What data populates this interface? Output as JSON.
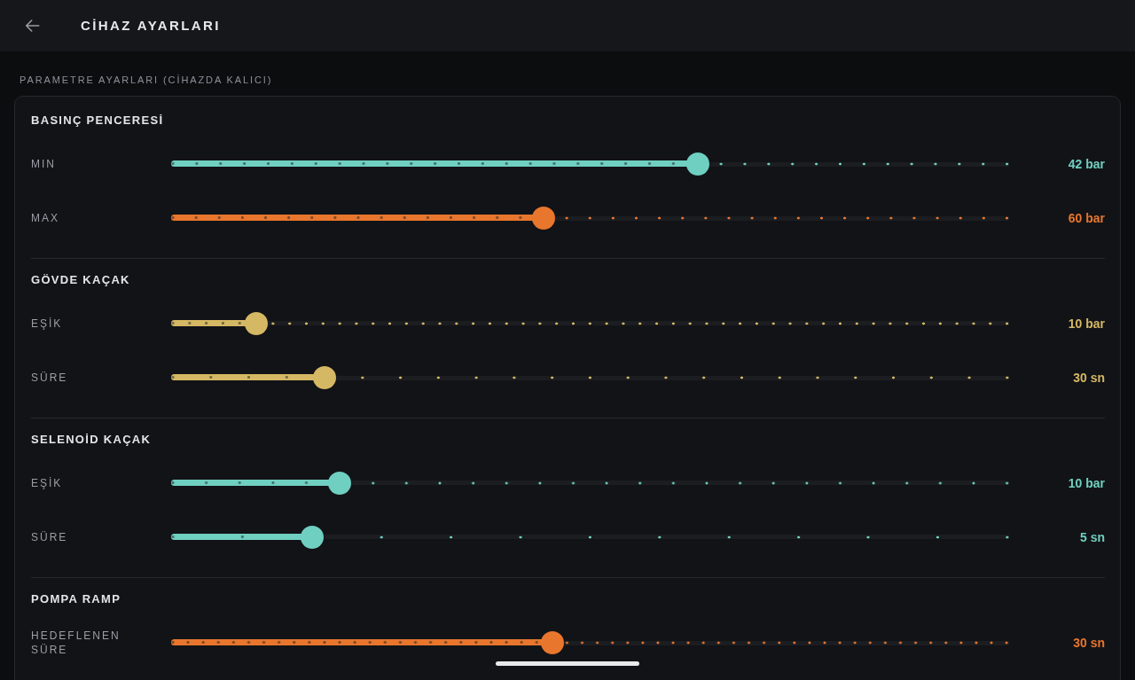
{
  "header": {
    "title": "CİHAZ AYARLARI"
  },
  "section_label": "PARAMETRE AYARLARI (CİHAZDA KALICI)",
  "groups": [
    {
      "title": "BASINÇ PENCERESİ",
      "sliders": [
        {
          "label": "MIN",
          "level": 0.629,
          "value": "42 bar",
          "color": "#6fcfc0"
        },
        {
          "label": "MAX",
          "level": 0.444,
          "value": "60 bar",
          "color": "#e8762d"
        }
      ]
    },
    {
      "title": "GÖVDE KAÇAK",
      "sliders": [
        {
          "label": "EŞİK",
          "level": 0.1,
          "value": "10 bar",
          "color": "#d5b863"
        },
        {
          "label": "SÜRE",
          "level": 0.182,
          "value": "30 sn",
          "color": "#d5b863"
        }
      ]
    },
    {
      "title": "SELENOİD KAÇAK",
      "sliders": [
        {
          "label": "EŞİK",
          "level": 0.2,
          "value": "10 bar",
          "color": "#6fcfc0"
        },
        {
          "label": "SÜRE",
          "level": 0.167,
          "value": "5 sn",
          "color": "#6fcfc0"
        }
      ]
    },
    {
      "title": "POMPA RAMP",
      "sliders": [
        {
          "label": "HEDEFLENEN SÜRE",
          "level": 0.455,
          "value": "30 sn",
          "color": "#e8762d"
        }
      ]
    }
  ]
}
